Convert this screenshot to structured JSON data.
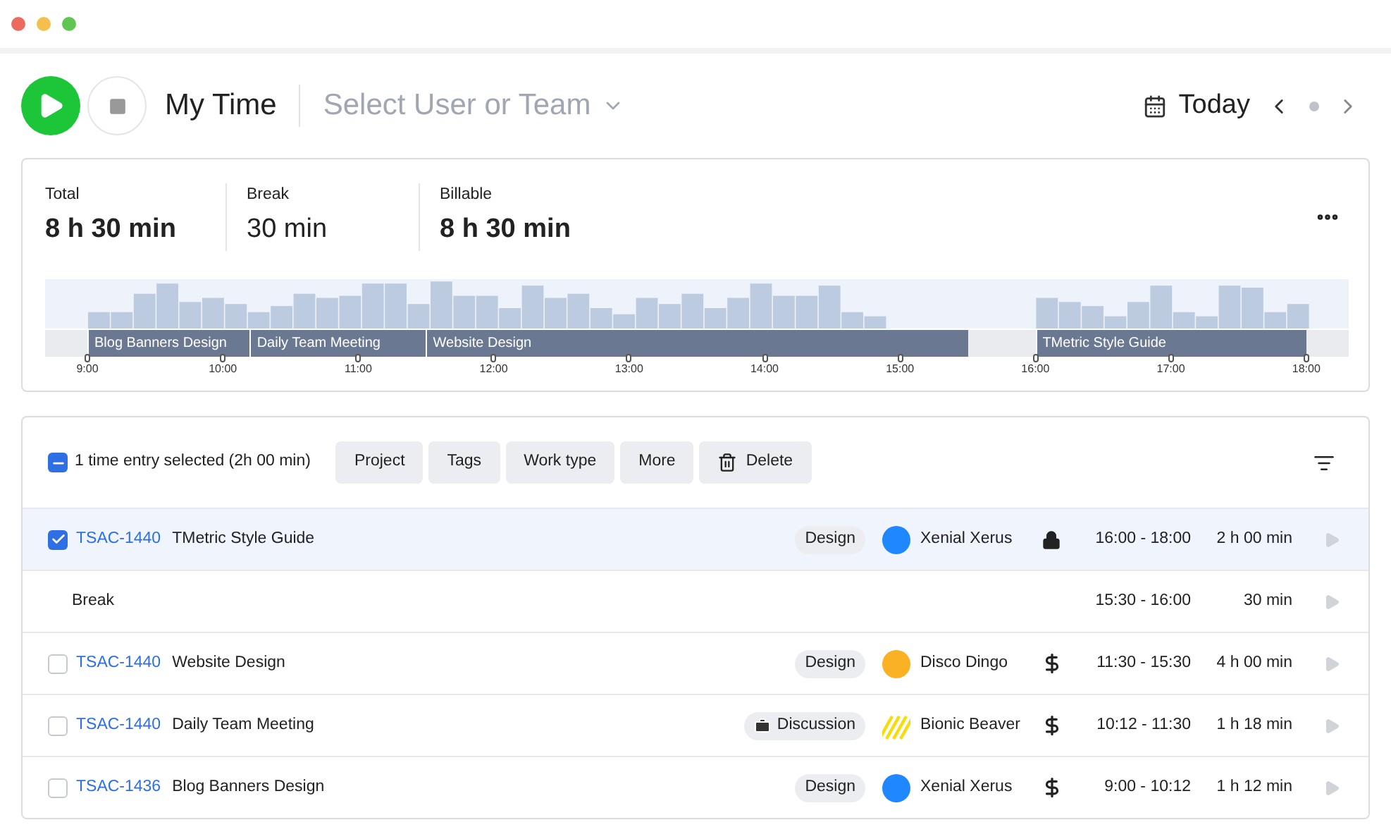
{
  "header": {
    "title": "My Time",
    "user_select": {
      "placeholder": "Select User or Team"
    },
    "date_label": "Today"
  },
  "summary": {
    "stats": [
      {
        "label": "Total",
        "value": "8 h 30 min",
        "bold": true
      },
      {
        "label": "Break",
        "value": "30 min",
        "bold": false
      },
      {
        "label": "Billable",
        "value": "8 h 30 min",
        "bold": true
      }
    ],
    "timeline": {
      "segments": [
        {
          "label": "Blog Banners Design"
        },
        {
          "label": "Daily Team Meeting"
        },
        {
          "label": "Website Design"
        },
        {
          "label": "TMetric Style Guide"
        }
      ],
      "ticks": [
        "9:00",
        "10:00",
        "11:00",
        "12:00",
        "13:00",
        "14:00",
        "15:00",
        "16:00",
        "17:00",
        "18:00"
      ]
    }
  },
  "toolbar": {
    "select_all": {
      "checked": true,
      "mixed": true
    },
    "selection_text": "1 time entry selected (2h 00 min)",
    "actions": [
      {
        "label": "Project",
        "kind": "text"
      },
      {
        "label": "Tags",
        "kind": "text"
      },
      {
        "label": "Work type",
        "kind": "text"
      },
      {
        "label": "More",
        "kind": "text"
      },
      {
        "label": "Delete",
        "kind": "delete"
      }
    ]
  },
  "entries": [
    {
      "kind": "entry",
      "selected": true,
      "code": "TSAC-1440",
      "title": "TMetric Style Guide",
      "tag": {
        "kind": "plain",
        "label": "Design"
      },
      "avatar": {
        "kind": "dot",
        "color": "#1f87ff"
      },
      "person": "Xenial Xerus",
      "billing": {
        "kind": "locked"
      },
      "time": "16:00 - 18:00",
      "duration": "2 h 00 min"
    },
    {
      "kind": "break",
      "title": "Break",
      "time": "15:30 - 16:00",
      "duration": "30 min"
    },
    {
      "kind": "entry",
      "selected": false,
      "code": "TSAC-1440",
      "title": "Website Design",
      "tag": {
        "kind": "plain",
        "label": "Design"
      },
      "avatar": {
        "kind": "dot",
        "color": "#fbb124"
      },
      "person": "Disco Dingo",
      "billing": {
        "kind": "billable"
      },
      "time": "11:30 - 15:30",
      "duration": "4 h 00 min"
    },
    {
      "kind": "entry",
      "selected": false,
      "code": "TSAC-1440",
      "title": "Daily Team Meeting",
      "tag": {
        "kind": "briefcase",
        "label": "Discussion"
      },
      "avatar": {
        "kind": "stripes",
        "color": "#f5dc0a"
      },
      "person": "Bionic Beaver",
      "billing": {
        "kind": "billable"
      },
      "time": "10:12 - 11:30",
      "duration": "1 h 18 min"
    },
    {
      "kind": "entry",
      "selected": false,
      "code": "TSAC-1436",
      "title": "Blog Banners Design",
      "tag": {
        "kind": "plain",
        "label": "Design"
      },
      "avatar": {
        "kind": "dot",
        "color": "#1f87ff"
      },
      "person": "Xenial Xerus",
      "billing": {
        "kind": "billable"
      },
      "time": "9:00 - 10:12",
      "duration": "1 h 12 min"
    }
  ]
}
